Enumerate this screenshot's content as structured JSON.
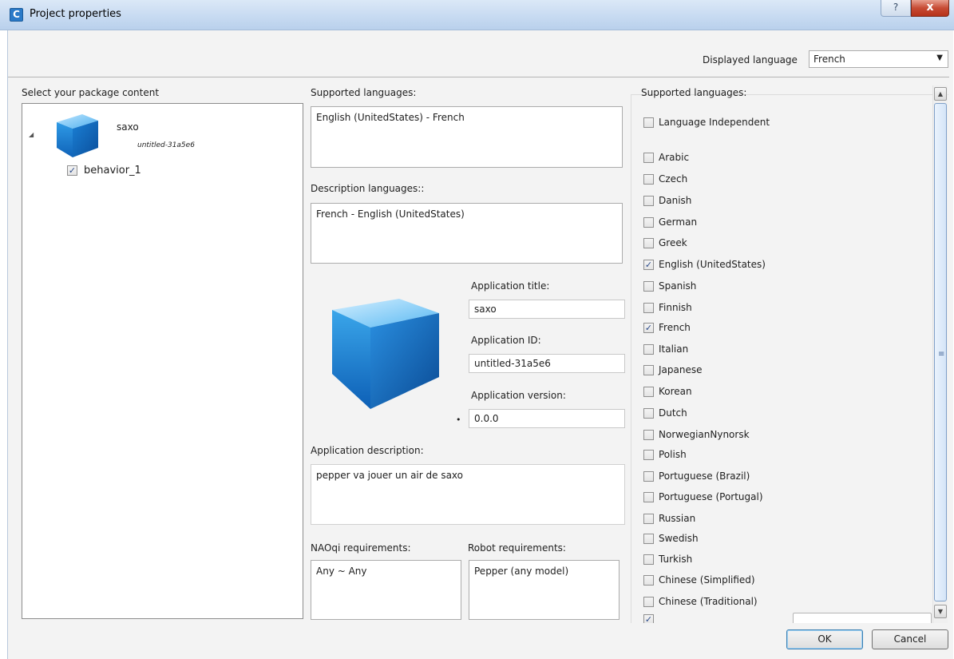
{
  "window": {
    "title": "Project properties",
    "app_icon_letter": "C",
    "help_glyph": "?",
    "close_glyph": "x"
  },
  "displayed_language": {
    "label": "Displayed language",
    "value": "French"
  },
  "package": {
    "label": "Select your package content",
    "root_name": "saxo",
    "root_id": "untitled-31a5e6",
    "child_name": "behavior_1",
    "child_checked": true
  },
  "languages_summary": {
    "supported_label": "Supported languages:",
    "supported_value": "English (UnitedStates) - French",
    "description_label": "Description languages::",
    "description_value": "French - English (UnitedStates)"
  },
  "application": {
    "title_label": "Application title:",
    "title_value": "saxo",
    "id_label": "Application ID:",
    "id_value": "untitled-31a5e6",
    "version_label": "Application version:",
    "version_value": "0.0.0",
    "version_marker": "•",
    "description_label": "Application description:",
    "description_value": "pepper va jouer un air de saxo"
  },
  "requirements": {
    "naoqi_label": "NAOqi requirements:",
    "naoqi_value": "Any ~ Any",
    "robot_label": "Robot requirements:",
    "robot_value": "Pepper (any model)"
  },
  "supported_languages": {
    "label": "Supported languages:",
    "items": [
      {
        "name": "Language Independent",
        "checked": false
      },
      {
        "name": "Arabic",
        "checked": false
      },
      {
        "name": "Czech",
        "checked": false
      },
      {
        "name": "Danish",
        "checked": false
      },
      {
        "name": "German",
        "checked": false
      },
      {
        "name": "Greek",
        "checked": false
      },
      {
        "name": "English (UnitedStates)",
        "checked": true
      },
      {
        "name": "Spanish",
        "checked": false
      },
      {
        "name": "Finnish",
        "checked": false
      },
      {
        "name": "French",
        "checked": true
      },
      {
        "name": "Italian",
        "checked": false
      },
      {
        "name": "Japanese",
        "checked": false
      },
      {
        "name": "Korean",
        "checked": false
      },
      {
        "name": "Dutch",
        "checked": false
      },
      {
        "name": "NorwegianNynorsk",
        "checked": false
      },
      {
        "name": "Polish",
        "checked": false
      },
      {
        "name": "Portuguese (Brazil)",
        "checked": false
      },
      {
        "name": "Portuguese (Portugal)",
        "checked": false
      },
      {
        "name": "Russian",
        "checked": false
      },
      {
        "name": "Swedish",
        "checked": false
      },
      {
        "name": "Turkish",
        "checked": false
      },
      {
        "name": "Chinese (Simplified)",
        "checked": false
      },
      {
        "name": "Chinese (Traditional)",
        "checked": false
      }
    ]
  },
  "buttons": {
    "ok": "OK",
    "cancel": "Cancel"
  },
  "colors": {
    "accent": "#2a7ac8",
    "checkmark": "#2a4a8a"
  }
}
